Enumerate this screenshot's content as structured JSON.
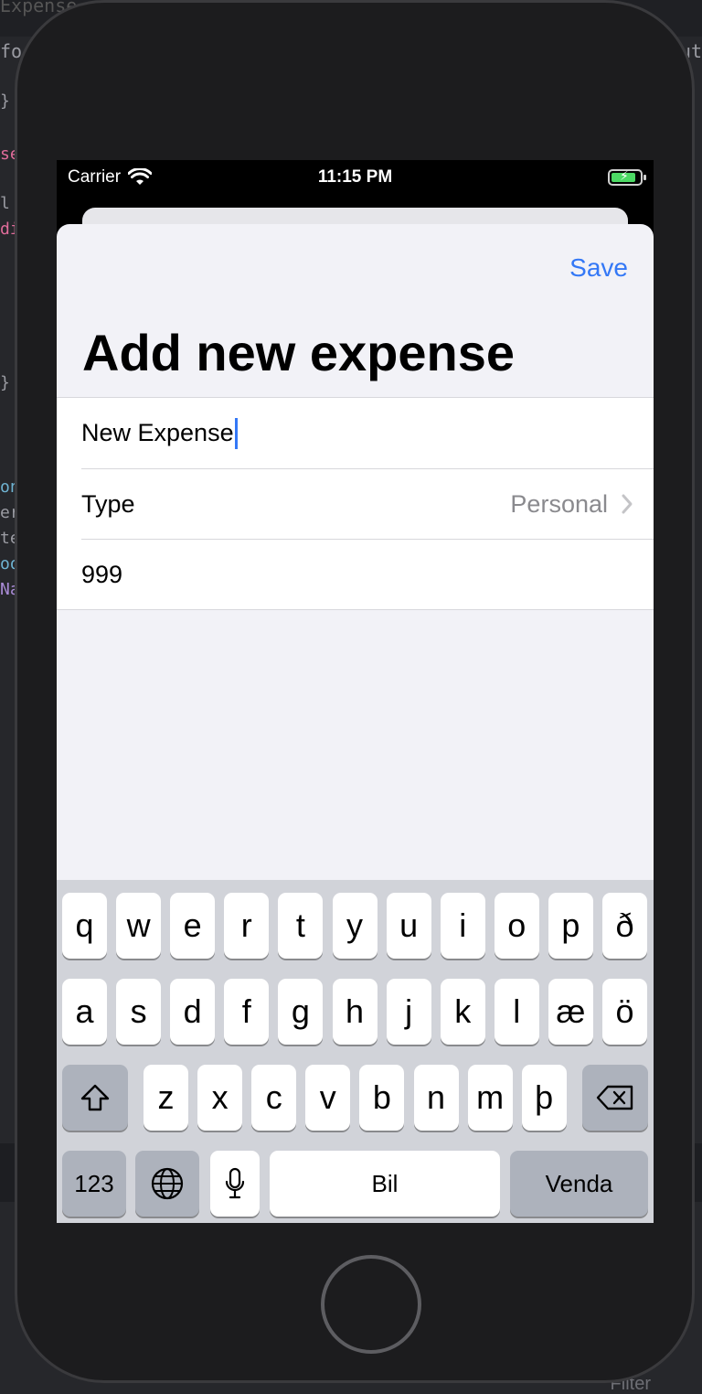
{
  "ide": {
    "title": "Expense",
    "tab_left": "for",
    "tab_right": "ut",
    "filter_label": "Filter",
    "code_fragments": [
      {
        "text": "}",
        "color": "#9b9ca3"
      },
      {
        "text": "se",
        "color": "#e06c9a"
      },
      {
        "text": "l",
        "color": "#9b9ca3"
      },
      {
        "text": "di",
        "color": "#e06c9a"
      },
      {
        "text": "}",
        "color": "#9b9ca3"
      },
      {
        "text": "on",
        "color": "#6fb3d2"
      },
      {
        "text": "er",
        "color": "#9b9ca3"
      },
      {
        "text": "te",
        "color": "#9b9ca3"
      },
      {
        "text": "oo",
        "color": "#6fb3d2"
      },
      {
        "text": "Na",
        "color": "#a98bd6"
      }
    ]
  },
  "status_bar": {
    "carrier": "Carrier",
    "time": "11:15 PM",
    "battery_color": "#4cd964"
  },
  "nav": {
    "save_label": "Save",
    "title": "Add new expense",
    "accent_color": "#3478f6"
  },
  "form": {
    "name_value": "New Expense",
    "type_label": "Type",
    "type_value": "Personal",
    "amount_value": "999"
  },
  "keyboard": {
    "row1": [
      "q",
      "w",
      "e",
      "r",
      "t",
      "y",
      "u",
      "i",
      "o",
      "p",
      "ð"
    ],
    "row2": [
      "a",
      "s",
      "d",
      "f",
      "g",
      "h",
      "j",
      "k",
      "l",
      "æ",
      "ö"
    ],
    "row3": [
      "z",
      "x",
      "c",
      "v",
      "b",
      "n",
      "m",
      "þ"
    ],
    "numbers_label": "123",
    "space_label": "Bil",
    "return_label": "Venda"
  }
}
